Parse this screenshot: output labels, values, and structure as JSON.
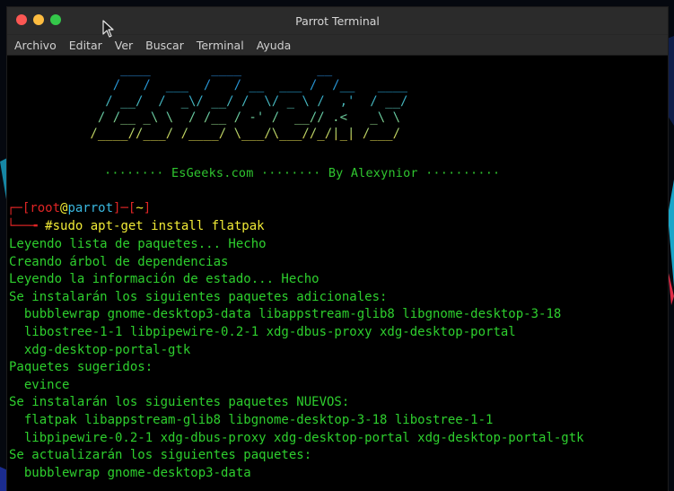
{
  "window": {
    "title": "Parrot Terminal",
    "controls": [
      "close",
      "minimize",
      "maximize"
    ]
  },
  "menu": [
    "Archivo",
    "Editar",
    "Ver",
    "Buscar",
    "Terminal",
    "Ayuda"
  ],
  "banner": {
    "ascii": "     ____        ____          __\n    /   /  ___  /   / __  ___ /  /__   ____\n   / __/  /  _\\/ __/ /  \\/ _ \\ /  ,'  / __/\n  / /__ _\\ \\  / /__ / -' /  __// .<   _\\ \\\n /____//___/ /____/ \\___/\\___//_/|_| /___/",
    "subtitle": "········ EsGeeks.com ········ By Alexynior ··········"
  },
  "prompt": {
    "open": "┌─[",
    "user": "root",
    "at": "@",
    "host": "parrot",
    "mid": "]─[",
    "dir": "~",
    "close": "]",
    "cmd_prefix": "└──╼ ",
    "symbol": "#",
    "command": "sudo apt-get install flatpak"
  },
  "output": [
    "Leyendo lista de paquetes... Hecho",
    "Creando árbol de dependencias",
    "Leyendo la información de estado... Hecho",
    "Se instalarán los siguientes paquetes adicionales:",
    "  bubblewrap gnome-desktop3-data libappstream-glib8 libgnome-desktop-3-18",
    "  libostree-1-1 libpipewire-0.2-1 xdg-dbus-proxy xdg-desktop-portal",
    "  xdg-desktop-portal-gtk",
    "Paquetes sugeridos:",
    "  evince",
    "Se instalarán los siguientes paquetes NUEVOS:",
    "  flatpak libappstream-glib8 libgnome-desktop-3-18 libostree-1-1",
    "  libpipewire-0.2-1 xdg-dbus-proxy xdg-desktop-portal xdg-desktop-portal-gtk",
    "Se actualizarán los siguientes paquetes:",
    "  bubblewrap gnome-desktop3-data"
  ],
  "colors": {
    "terminal_bg": "#000000",
    "text_green": "#2ecf2e",
    "prompt_red": "#e02525",
    "prompt_host": "#3ab8e0",
    "prompt_yellow": "#f0ea36",
    "titlebar": "#2b2b2b"
  }
}
